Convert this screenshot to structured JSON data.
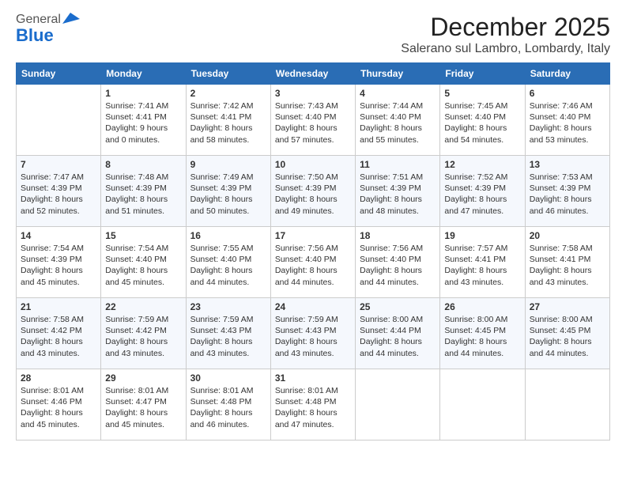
{
  "header": {
    "logo_general": "General",
    "logo_blue": "Blue",
    "month": "December 2025",
    "location": "Salerano sul Lambro, Lombardy, Italy"
  },
  "days_of_week": [
    "Sunday",
    "Monday",
    "Tuesday",
    "Wednesday",
    "Thursday",
    "Friday",
    "Saturday"
  ],
  "weeks": [
    [
      {
        "day": "",
        "sunrise": "",
        "sunset": "",
        "daylight": ""
      },
      {
        "day": "1",
        "sunrise": "Sunrise: 7:41 AM",
        "sunset": "Sunset: 4:41 PM",
        "daylight": "Daylight: 9 hours and 0 minutes."
      },
      {
        "day": "2",
        "sunrise": "Sunrise: 7:42 AM",
        "sunset": "Sunset: 4:41 PM",
        "daylight": "Daylight: 8 hours and 58 minutes."
      },
      {
        "day": "3",
        "sunrise": "Sunrise: 7:43 AM",
        "sunset": "Sunset: 4:40 PM",
        "daylight": "Daylight: 8 hours and 57 minutes."
      },
      {
        "day": "4",
        "sunrise": "Sunrise: 7:44 AM",
        "sunset": "Sunset: 4:40 PM",
        "daylight": "Daylight: 8 hours and 55 minutes."
      },
      {
        "day": "5",
        "sunrise": "Sunrise: 7:45 AM",
        "sunset": "Sunset: 4:40 PM",
        "daylight": "Daylight: 8 hours and 54 minutes."
      },
      {
        "day": "6",
        "sunrise": "Sunrise: 7:46 AM",
        "sunset": "Sunset: 4:40 PM",
        "daylight": "Daylight: 8 hours and 53 minutes."
      }
    ],
    [
      {
        "day": "7",
        "sunrise": "Sunrise: 7:47 AM",
        "sunset": "Sunset: 4:39 PM",
        "daylight": "Daylight: 8 hours and 52 minutes."
      },
      {
        "day": "8",
        "sunrise": "Sunrise: 7:48 AM",
        "sunset": "Sunset: 4:39 PM",
        "daylight": "Daylight: 8 hours and 51 minutes."
      },
      {
        "day": "9",
        "sunrise": "Sunrise: 7:49 AM",
        "sunset": "Sunset: 4:39 PM",
        "daylight": "Daylight: 8 hours and 50 minutes."
      },
      {
        "day": "10",
        "sunrise": "Sunrise: 7:50 AM",
        "sunset": "Sunset: 4:39 PM",
        "daylight": "Daylight: 8 hours and 49 minutes."
      },
      {
        "day": "11",
        "sunrise": "Sunrise: 7:51 AM",
        "sunset": "Sunset: 4:39 PM",
        "daylight": "Daylight: 8 hours and 48 minutes."
      },
      {
        "day": "12",
        "sunrise": "Sunrise: 7:52 AM",
        "sunset": "Sunset: 4:39 PM",
        "daylight": "Daylight: 8 hours and 47 minutes."
      },
      {
        "day": "13",
        "sunrise": "Sunrise: 7:53 AM",
        "sunset": "Sunset: 4:39 PM",
        "daylight": "Daylight: 8 hours and 46 minutes."
      }
    ],
    [
      {
        "day": "14",
        "sunrise": "Sunrise: 7:54 AM",
        "sunset": "Sunset: 4:39 PM",
        "daylight": "Daylight: 8 hours and 45 minutes."
      },
      {
        "day": "15",
        "sunrise": "Sunrise: 7:54 AM",
        "sunset": "Sunset: 4:40 PM",
        "daylight": "Daylight: 8 hours and 45 minutes."
      },
      {
        "day": "16",
        "sunrise": "Sunrise: 7:55 AM",
        "sunset": "Sunset: 4:40 PM",
        "daylight": "Daylight: 8 hours and 44 minutes."
      },
      {
        "day": "17",
        "sunrise": "Sunrise: 7:56 AM",
        "sunset": "Sunset: 4:40 PM",
        "daylight": "Daylight: 8 hours and 44 minutes."
      },
      {
        "day": "18",
        "sunrise": "Sunrise: 7:56 AM",
        "sunset": "Sunset: 4:40 PM",
        "daylight": "Daylight: 8 hours and 44 minutes."
      },
      {
        "day": "19",
        "sunrise": "Sunrise: 7:57 AM",
        "sunset": "Sunset: 4:41 PM",
        "daylight": "Daylight: 8 hours and 43 minutes."
      },
      {
        "day": "20",
        "sunrise": "Sunrise: 7:58 AM",
        "sunset": "Sunset: 4:41 PM",
        "daylight": "Daylight: 8 hours and 43 minutes."
      }
    ],
    [
      {
        "day": "21",
        "sunrise": "Sunrise: 7:58 AM",
        "sunset": "Sunset: 4:42 PM",
        "daylight": "Daylight: 8 hours and 43 minutes."
      },
      {
        "day": "22",
        "sunrise": "Sunrise: 7:59 AM",
        "sunset": "Sunset: 4:42 PM",
        "daylight": "Daylight: 8 hours and 43 minutes."
      },
      {
        "day": "23",
        "sunrise": "Sunrise: 7:59 AM",
        "sunset": "Sunset: 4:43 PM",
        "daylight": "Daylight: 8 hours and 43 minutes."
      },
      {
        "day": "24",
        "sunrise": "Sunrise: 7:59 AM",
        "sunset": "Sunset: 4:43 PM",
        "daylight": "Daylight: 8 hours and 43 minutes."
      },
      {
        "day": "25",
        "sunrise": "Sunrise: 8:00 AM",
        "sunset": "Sunset: 4:44 PM",
        "daylight": "Daylight: 8 hours and 44 minutes."
      },
      {
        "day": "26",
        "sunrise": "Sunrise: 8:00 AM",
        "sunset": "Sunset: 4:45 PM",
        "daylight": "Daylight: 8 hours and 44 minutes."
      },
      {
        "day": "27",
        "sunrise": "Sunrise: 8:00 AM",
        "sunset": "Sunset: 4:45 PM",
        "daylight": "Daylight: 8 hours and 44 minutes."
      }
    ],
    [
      {
        "day": "28",
        "sunrise": "Sunrise: 8:01 AM",
        "sunset": "Sunset: 4:46 PM",
        "daylight": "Daylight: 8 hours and 45 minutes."
      },
      {
        "day": "29",
        "sunrise": "Sunrise: 8:01 AM",
        "sunset": "Sunset: 4:47 PM",
        "daylight": "Daylight: 8 hours and 45 minutes."
      },
      {
        "day": "30",
        "sunrise": "Sunrise: 8:01 AM",
        "sunset": "Sunset: 4:48 PM",
        "daylight": "Daylight: 8 hours and 46 minutes."
      },
      {
        "day": "31",
        "sunrise": "Sunrise: 8:01 AM",
        "sunset": "Sunset: 4:48 PM",
        "daylight": "Daylight: 8 hours and 47 minutes."
      },
      {
        "day": "",
        "sunrise": "",
        "sunset": "",
        "daylight": ""
      },
      {
        "day": "",
        "sunrise": "",
        "sunset": "",
        "daylight": ""
      },
      {
        "day": "",
        "sunrise": "",
        "sunset": "",
        "daylight": ""
      }
    ]
  ]
}
